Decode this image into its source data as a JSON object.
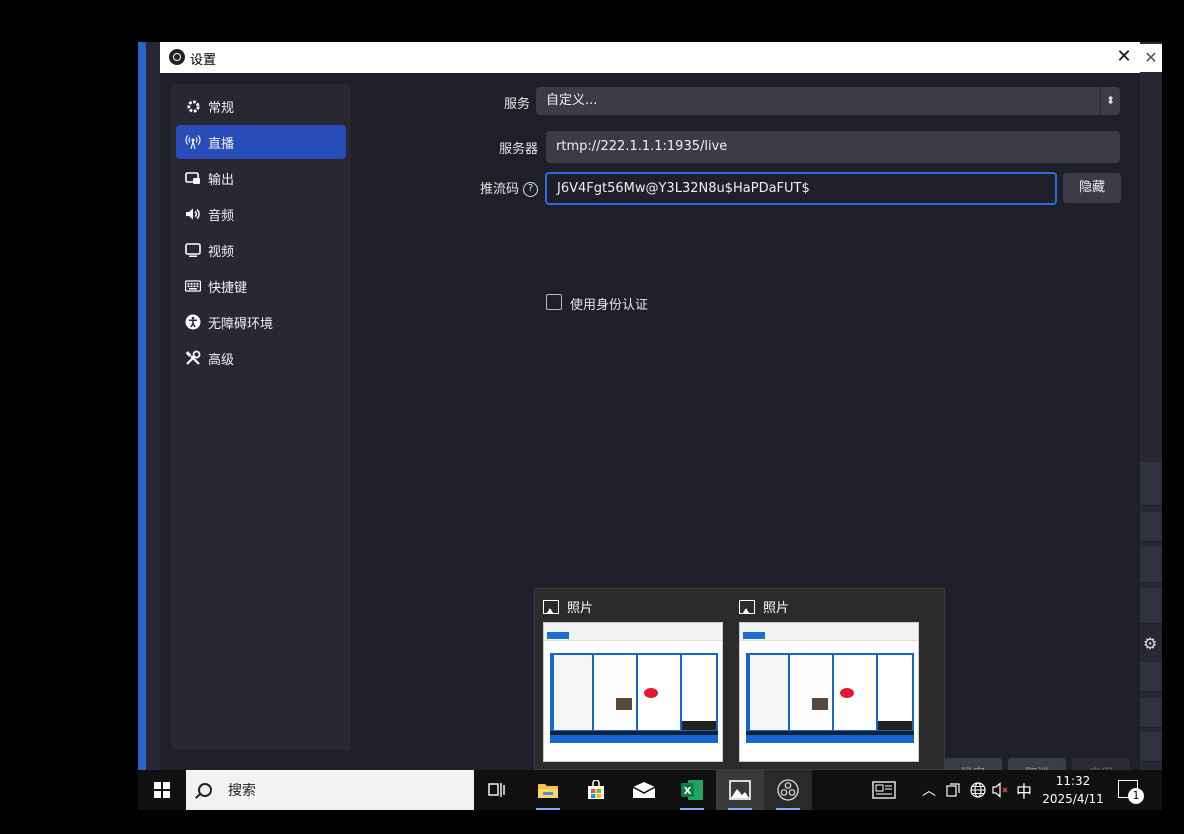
{
  "dialog": {
    "title": "设置",
    "close_glyph": "✕"
  },
  "sidebar": {
    "items": [
      {
        "label": "常规",
        "icon": "gear-icon"
      },
      {
        "label": "直播",
        "icon": "broadcast-icon"
      },
      {
        "label": "输出",
        "icon": "output-icon"
      },
      {
        "label": "音频",
        "icon": "speaker-icon"
      },
      {
        "label": "视频",
        "icon": "monitor-icon"
      },
      {
        "label": "快捷键",
        "icon": "keyboard-icon"
      },
      {
        "label": "无障碍环境",
        "icon": "accessibility-icon"
      },
      {
        "label": "高级",
        "icon": "tools-icon"
      }
    ],
    "active_index": 1
  },
  "stream": {
    "service_label": "服务",
    "service_value": "自定义...",
    "server_label": "服务器",
    "server_value": "rtmp://222.1.1.1:1935/live",
    "key_label": "推流码",
    "key_value": "J6V4Fgt56Mw@Y3L32N8u$HaPDaFUT$",
    "hide_button": "隐藏",
    "auth_checkbox_label": "使用身份认证",
    "auth_checked": false
  },
  "bottom_buttons": [
    "确定",
    "取消",
    "应用"
  ],
  "thumbnails": [
    {
      "title": "照片",
      "app_icon": "photos-icon"
    },
    {
      "title": "照片",
      "app_icon": "photos-icon"
    }
  ],
  "taskbar": {
    "search_placeholder": "搜索",
    "apps": [
      "task-view-icon",
      "file-explorer-icon",
      "store-icon",
      "mail-icon",
      "excel-icon",
      "photos-icon",
      "obs-icon"
    ],
    "tray": {
      "ime": "中",
      "time": "11:32",
      "date": "2025/4/11",
      "notification_count": "1"
    }
  },
  "colors": {
    "accent": "#284cb8",
    "focus_border": "#2d6be0",
    "panel": "#272833",
    "background": "#1e1f29"
  }
}
